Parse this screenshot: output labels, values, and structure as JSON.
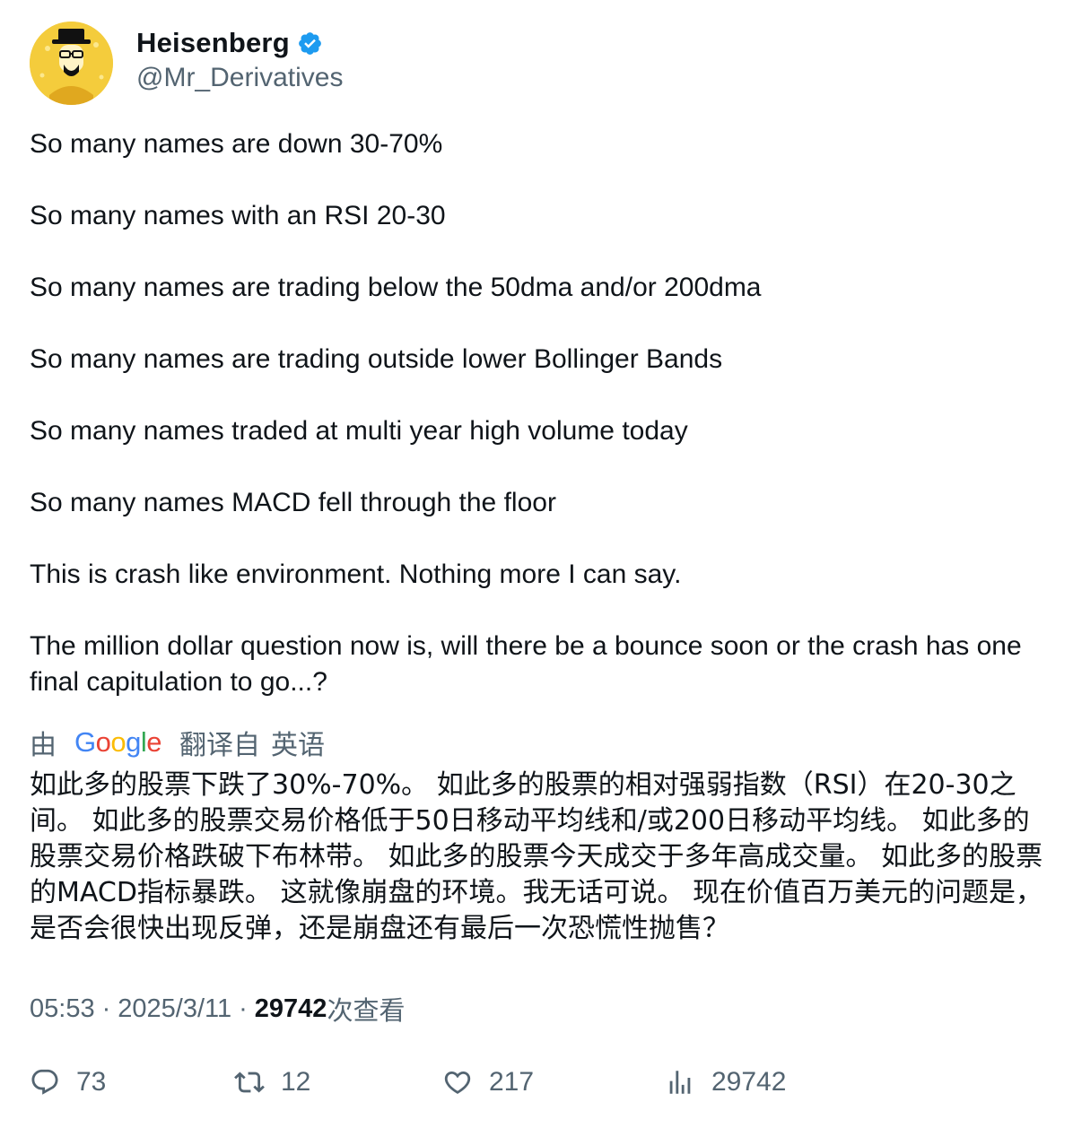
{
  "author": {
    "display_name": "Heisenberg",
    "handle": "@Mr_Derivatives",
    "verified": true,
    "avatar_icon": "heisenberg-avatar-icon",
    "accent_color": "#1d9bf0"
  },
  "tweet": {
    "paragraphs": [
      "So many names are down 30-70%",
      "So many names with an RSI 20-30",
      "So many names are trading below the 50dma and/or 200dma",
      "So many names are trading outside lower Bollinger Bands",
      "So many names traded at multi year high volume today",
      "So many names MACD fell through the floor",
      "This is crash like environment. Nothing more I can say.",
      "The million dollar question now is, will there be a bounce soon or the crash has one final capitulation to go...?"
    ]
  },
  "translation": {
    "prefix": "由",
    "google_letters": [
      "G",
      "o",
      "o",
      "g",
      "l",
      "e"
    ],
    "translated_from": "翻译自",
    "language": "英语",
    "text": "如此多的股票下跌了30%-70%。 如此多的股票的相对强弱指数（RSI）在20-30之间。 如此多的股票交易价格低于50日移动平均线和/或200日移动平均线。 如此多的股票交易价格跌破下布林带。 如此多的股票今天成交于多年高成交量。 如此多的股票的MACD指标暴跌。 这就像崩盘的环境。我无话可说。 现在价值百万美元的问题是，是否会很快出现反弹，还是崩盘还有最后一次恐慌性抛售？"
  },
  "meta": {
    "time": "05:53",
    "separator": "·",
    "date": "2025/3/11",
    "views_count": "29742",
    "views_label": "次查看"
  },
  "actions": {
    "replies": "73",
    "retweets": "12",
    "likes": "217",
    "views": "29742"
  }
}
